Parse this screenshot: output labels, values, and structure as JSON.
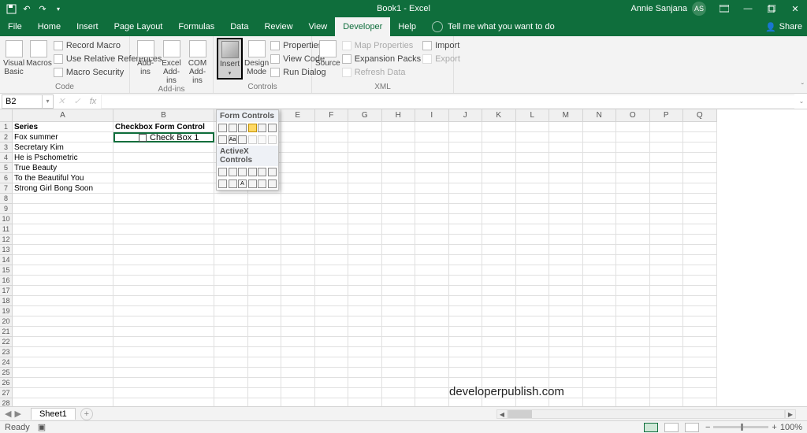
{
  "title": "Book1 - Excel",
  "user": {
    "name": "Annie Sanjana",
    "initials": "AS"
  },
  "tabs": [
    "File",
    "Home",
    "Insert",
    "Page Layout",
    "Formulas",
    "Data",
    "Review",
    "View",
    "Developer",
    "Help"
  ],
  "active_tab": "Developer",
  "tell_me": "Tell me what you want to do",
  "share": "Share",
  "ribbon": {
    "code": {
      "visual_basic": "Visual\nBasic",
      "macros": "Macros",
      "record": "Record Macro",
      "relative": "Use Relative References",
      "security": "Macro Security",
      "label": "Code"
    },
    "addins": {
      "addins": "Add-\nins",
      "excel": "Excel\nAdd-ins",
      "com": "COM\nAdd-ins",
      "label": "Add-ins"
    },
    "controls": {
      "insert": "Insert",
      "design": "Design\nMode",
      "properties": "Properties",
      "view_code": "View Code",
      "run_dialog": "Run Dialog",
      "label": "Controls"
    },
    "xml": {
      "source": "Source",
      "map_props": "Map Properties",
      "expansion": "Expansion Packs",
      "refresh": "Refresh Data",
      "import": "Import",
      "export": "Export",
      "label": "XML"
    }
  },
  "namebox": "B2",
  "fx": "fx",
  "columns": [
    "A",
    "B",
    "C",
    "D",
    "E",
    "F",
    "G",
    "H",
    "I",
    "J",
    "K",
    "L",
    "M",
    "N",
    "O",
    "P",
    "Q"
  ],
  "rows_count": 29,
  "cells": {
    "A1": "Series",
    "A2": "Fox summer",
    "A3": "Secretary Kim",
    "A4": "He is Pschometric",
    "A5": "True Beauty",
    "A6": "To the Beautiful You",
    "A7": "Strong Girl Bong Soon",
    "B1": "Checkbox Form Control",
    "C1_overflow": "ontrol"
  },
  "checkbox_label": "Check Box 1",
  "dropdown": {
    "form_controls": "Form Controls",
    "activex_controls": "ActiveX Controls"
  },
  "watermark": "developerpublish.com",
  "sheet": "Sheet1",
  "status": {
    "ready": "Ready",
    "zoom": "100%"
  }
}
